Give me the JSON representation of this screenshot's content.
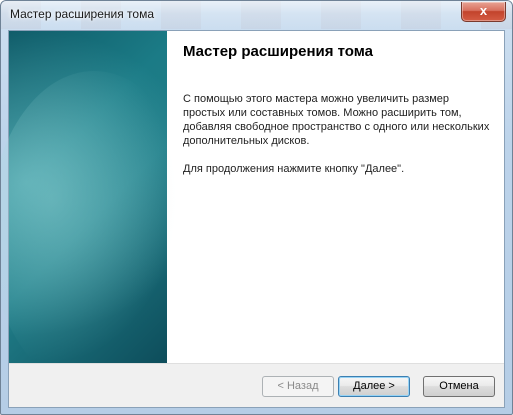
{
  "window": {
    "title": "Мастер расширения тома",
    "close_glyph": "x"
  },
  "page": {
    "heading": "Мастер расширения тома",
    "paragraph1": "С помощью этого мастера можно увеличить размер простых или составных томов. Можно расширить том, добавляя свободное пространство с одного или нескольких дополнительных дисков.",
    "paragraph2": "Для продолжения нажмите кнопку \"Далее\"."
  },
  "buttons": {
    "back": "< Назад",
    "next": "Далее >",
    "cancel": "Отмена"
  },
  "colors": {
    "side_panel": "#1b7b86",
    "close_button": "#c2432c"
  }
}
